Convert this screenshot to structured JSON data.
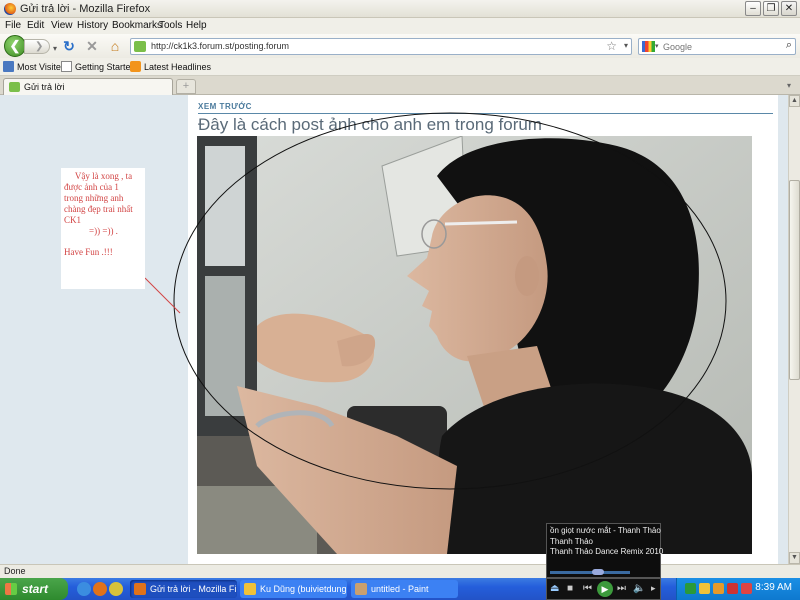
{
  "window": {
    "title": "Gửi trả lời - Mozilla Firefox"
  },
  "menu": [
    "File",
    "Edit",
    "View",
    "History",
    "Bookmarks",
    "Tools",
    "Help"
  ],
  "nav": {
    "url": "http://ck1k3.forum.st/posting.forum",
    "search_placeholder": "Google"
  },
  "bookmarks": [
    "Most Visited",
    "Getting Started",
    "Latest Headlines"
  ],
  "tabs": [
    {
      "label": "Gửi trả lời"
    }
  ],
  "page": {
    "section_label": "XEM TRƯỚC",
    "post_title": "Đây là cách post ảnh cho anh em trong forum",
    "note_lines": [
      "Vậy là xong , ta",
      "được ảnh của 1",
      "trong những anh",
      "chàng đẹp trai nhất",
      "CK1",
      "=)) =)) .",
      "Have Fun .!!!"
    ]
  },
  "status": {
    "text": "Done"
  },
  "taskbar": {
    "start_label": "start",
    "tasks": [
      "Gửi trả lời - Mozilla Fir...",
      "Ku Dũng (buivietdung...",
      "untitled - Paint"
    ],
    "clock": "8:39 AM"
  },
  "media_player": {
    "track": "ồn giọt nước mắt - Thanh Thảo",
    "artist": "Thanh Thảo",
    "album": "Thanh Thảo Dance Remix 2010",
    "progress": 0.6
  },
  "colors": {
    "accent_blue": "#245edb",
    "note_text": "#d24545",
    "page_bg": "#dfe8ee"
  }
}
